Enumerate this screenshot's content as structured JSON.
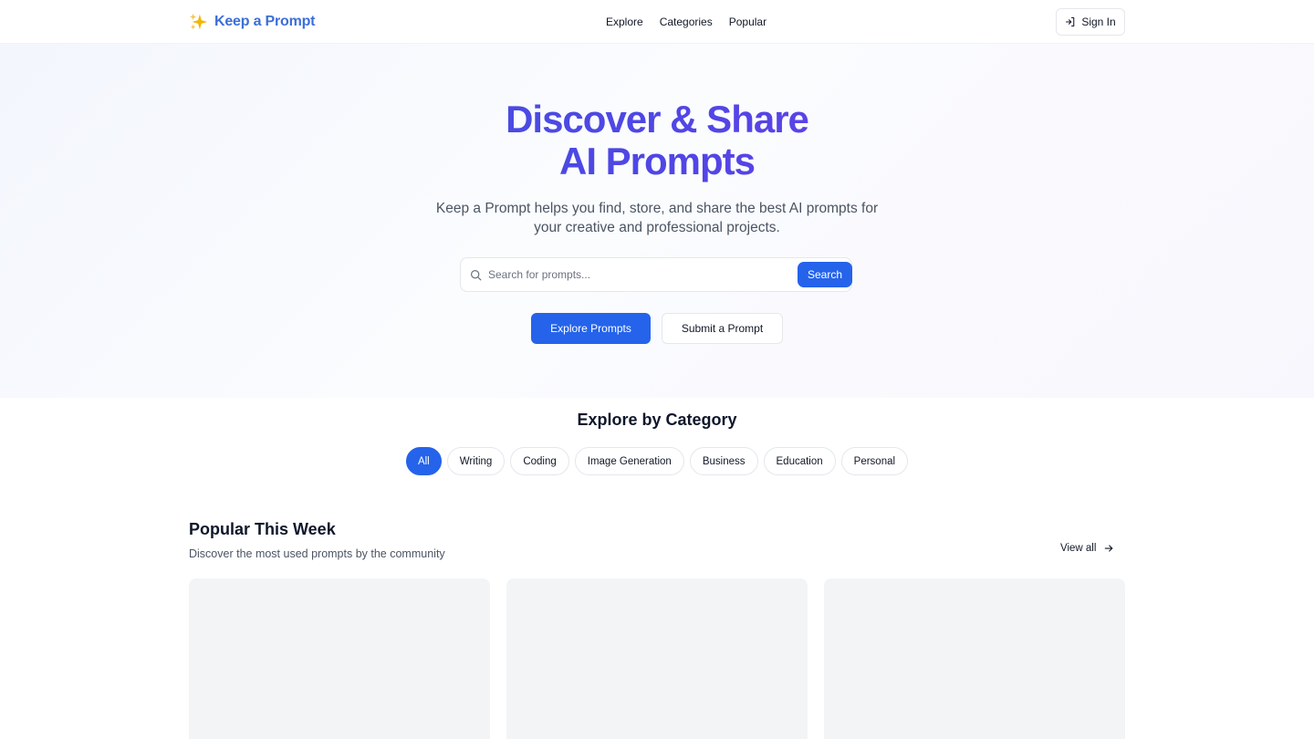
{
  "header": {
    "logo_text": "Keep a Prompt",
    "logo_icon": "sparkles-icon",
    "nav": [
      "Explore",
      "Categories",
      "Popular"
    ],
    "signin_label": "Sign In"
  },
  "hero": {
    "title_line1": "Discover & Share",
    "title_line2": "AI Prompts",
    "subtitle": "Keep a Prompt helps you find, store, and share the best AI prompts for your creative and professional projects.",
    "search_placeholder": "Search for prompts...",
    "search_value": "",
    "search_button": "Search",
    "primary_button": "Explore Prompts",
    "secondary_button": "Submit a Prompt"
  },
  "categories": {
    "title": "Explore by Category",
    "selected": "All",
    "items": [
      "All",
      "Writing",
      "Coding",
      "Image Generation",
      "Business",
      "Education",
      "Personal"
    ]
  },
  "popular": {
    "title": "Popular This Week",
    "subtitle": "Discover the most used prompts by the community",
    "view_all": "View all"
  },
  "colors": {
    "accent": "#2563eb",
    "logo": "#3b6fd8",
    "title_gradient_start": "#3b5bdb",
    "title_gradient_end": "#7c3aed",
    "card_placeholder": "#f3f4f6"
  }
}
